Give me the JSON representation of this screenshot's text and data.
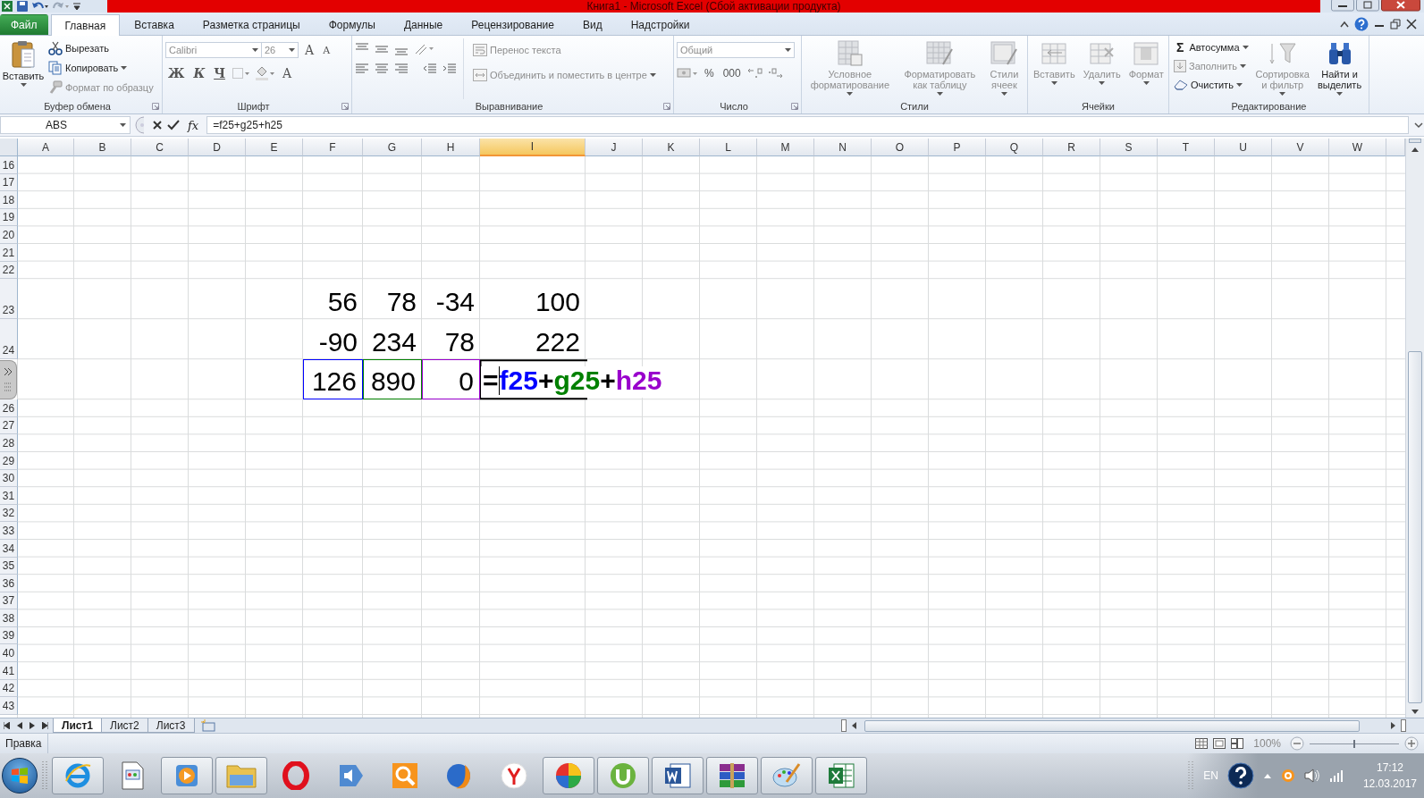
{
  "window": {
    "title": "Книга1  -  Microsoft Excel (Сбой активации продукта)"
  },
  "menu_tabs": [
    {
      "label": "Файл",
      "kind": "file",
      "selected": false
    },
    {
      "label": "Главная",
      "kind": "tab",
      "selected": true
    },
    {
      "label": "Вставка",
      "kind": "tab",
      "selected": false
    },
    {
      "label": "Разметка страницы",
      "kind": "tab",
      "selected": false
    },
    {
      "label": "Формулы",
      "kind": "tab",
      "selected": false
    },
    {
      "label": "Данные",
      "kind": "tab",
      "selected": false
    },
    {
      "label": "Рецензирование",
      "kind": "tab",
      "selected": false
    },
    {
      "label": "Вид",
      "kind": "tab",
      "selected": false
    },
    {
      "label": "Надстройки",
      "kind": "tab",
      "selected": false
    }
  ],
  "ribbon": {
    "clipboard": {
      "title": "Буфер обмена",
      "launcher": true,
      "paste": {
        "label": "Вставить",
        "disabled": false,
        "dropdown": true
      },
      "items": [
        {
          "label": "Вырезать",
          "kind": "cut",
          "disabled": false,
          "dropdown": false
        },
        {
          "label": "Копировать",
          "kind": "copy",
          "disabled": false,
          "dropdown": true
        },
        {
          "label": "Формат по образцу",
          "kind": "painter",
          "disabled": true,
          "dropdown": false
        }
      ]
    },
    "font": {
      "title": "Шрифт",
      "launcher": true,
      "font_name": "Calibri",
      "font_size": "26",
      "size_buttons": [
        {
          "label": "A",
          "kind": "grow"
        },
        {
          "label": "A",
          "kind": "shrink"
        }
      ],
      "styles": [
        {
          "label": "Ж",
          "kind": "bold"
        },
        {
          "label": "К",
          "kind": "italic"
        },
        {
          "label": "Ч",
          "kind": "underline"
        }
      ],
      "color_button": {
        "label": "A"
      }
    },
    "alignment": {
      "title": "Выравнивание",
      "launcher": true,
      "items": [
        {
          "label": "Перенос текста",
          "kind": "wrap",
          "disabled": true,
          "dropdown": false
        },
        {
          "label": "Объединить и поместить в центре",
          "kind": "merge",
          "disabled": true,
          "dropdown": true
        }
      ]
    },
    "number": {
      "title": "Число",
      "launcher": true,
      "format": "Общий",
      "buttons": [
        {
          "label": "%"
        },
        {
          "label": "000"
        }
      ]
    },
    "styles": {
      "title": "Стили",
      "launcher": false,
      "items": [
        {
          "label": "Условное\nформатирование",
          "kind": "conditional",
          "disabled": true,
          "dropdown": true
        },
        {
          "label": "Форматировать\nкак таблицу",
          "kind": "table",
          "disabled": true,
          "dropdown": true
        },
        {
          "label": "Стили\nячеек",
          "kind": "cellstyle",
          "disabled": true,
          "dropdown": true
        }
      ]
    },
    "cells": {
      "title": "Ячейки",
      "launcher": false,
      "items": [
        {
          "label": "Вставить",
          "kind": "insert",
          "disabled": true,
          "dropdown": true
        },
        {
          "label": "Удалить",
          "kind": "delete",
          "disabled": true,
          "dropdown": true
        },
        {
          "label": "Формат",
          "kind": "format",
          "disabled": true,
          "dropdown": true
        }
      ]
    },
    "editing": {
      "title": "Редактирование",
      "launcher": false,
      "small": [
        {
          "label": "Автосумма",
          "kind": "autosum",
          "symbol": "Σ",
          "disabled": false,
          "dropdown": true
        },
        {
          "label": "Заполнить",
          "kind": "fill",
          "disabled": true,
          "dropdown": true
        },
        {
          "label": "Очистить",
          "kind": "clear",
          "disabled": false,
          "dropdown": true
        }
      ],
      "big": [
        {
          "label": "Сортировка\nи фильтр",
          "kind": "sort",
          "disabled": true,
          "dropdown": true
        },
        {
          "label": "Найти и\nвыделить",
          "kind": "find",
          "disabled": false,
          "dropdown": true
        }
      ]
    }
  },
  "formula_bar": {
    "name_box": "ABS",
    "fx": "fx",
    "formula": "=f25+g25+h25"
  },
  "sheet": {
    "columns": [
      {
        "label": "A",
        "selected": false
      },
      {
        "label": "B",
        "selected": false
      },
      {
        "label": "C",
        "selected": false
      },
      {
        "label": "D",
        "selected": false
      },
      {
        "label": "E",
        "selected": false
      },
      {
        "label": "F",
        "selected": false
      },
      {
        "label": "G",
        "selected": false
      },
      {
        "label": "H",
        "selected": false
      },
      {
        "label": "I",
        "selected": true
      },
      {
        "label": "J",
        "selected": false
      },
      {
        "label": "K",
        "selected": false
      },
      {
        "label": "L",
        "selected": false
      },
      {
        "label": "M",
        "selected": false
      },
      {
        "label": "N",
        "selected": false
      },
      {
        "label": "O",
        "selected": false
      },
      {
        "label": "P",
        "selected": false
      },
      {
        "label": "Q",
        "selected": false
      },
      {
        "label": "R",
        "selected": false
      },
      {
        "label": "S",
        "selected": false
      },
      {
        "label": "T",
        "selected": false
      },
      {
        "label": "U",
        "selected": false
      },
      {
        "label": "V",
        "selected": false
      },
      {
        "label": "W",
        "selected": false
      }
    ],
    "rows": [
      {
        "number": "16",
        "kind": "normal"
      },
      {
        "number": "17",
        "kind": "normal"
      },
      {
        "number": "18",
        "kind": "normal"
      },
      {
        "number": "19",
        "kind": "normal"
      },
      {
        "number": "20",
        "kind": "normal"
      },
      {
        "number": "21",
        "kind": "normal"
      },
      {
        "number": "22",
        "kind": "normal"
      },
      {
        "number": "23",
        "kind": "large",
        "cells": [
          {
            "value": "56"
          },
          {
            "value": "78"
          },
          {
            "value": "-34"
          },
          {
            "value": "100"
          }
        ]
      },
      {
        "number": "24",
        "kind": "large",
        "cells": [
          {
            "value": "-90"
          },
          {
            "value": "234"
          },
          {
            "value": "78"
          },
          {
            "value": "222"
          }
        ]
      },
      {
        "kind": "large",
        "cells": [
          {
            "value": "126",
            "color": "#0000ff"
          },
          {
            "value": "890",
            "color": "#008000"
          },
          {
            "value": "0",
            "color": "#9900cc"
          }
        ],
        "editor": {
          "parts": [
            {
              "text": "=",
              "color": "#000000"
            },
            {
              "text": "f25",
              "color": "#0000ff"
            },
            {
              "text": "+",
              "color": "#000000"
            },
            {
              "text": "g25",
              "color": "#008000"
            },
            {
              "text": "+",
              "color": "#000000"
            },
            {
              "text": "h25",
              "color": "#9900cc"
            }
          ]
        }
      },
      {
        "number": "26",
        "kind": "normal"
      },
      {
        "number": "27",
        "kind": "normal"
      },
      {
        "number": "28",
        "kind": "normal"
      },
      {
        "number": "29",
        "kind": "normal"
      },
      {
        "number": "30",
        "kind": "normal"
      },
      {
        "number": "31",
        "kind": "normal"
      },
      {
        "number": "32",
        "kind": "normal"
      },
      {
        "number": "33",
        "kind": "normal"
      },
      {
        "number": "34",
        "kind": "normal"
      },
      {
        "number": "35",
        "kind": "normal"
      },
      {
        "number": "36",
        "kind": "normal"
      },
      {
        "number": "37",
        "kind": "normal"
      },
      {
        "number": "38",
        "kind": "normal"
      },
      {
        "number": "39",
        "kind": "normal"
      },
      {
        "number": "40",
        "kind": "normal"
      },
      {
        "number": "41",
        "kind": "normal"
      },
      {
        "number": "42",
        "kind": "normal"
      },
      {
        "number": "43",
        "kind": "normal"
      }
    ]
  },
  "sheet_tabs": [
    {
      "label": "Лист1",
      "selected": true
    },
    {
      "label": "Лист2",
      "selected": false
    },
    {
      "label": "Лист3",
      "selected": false
    }
  ],
  "status_bar": {
    "mode": "Правка",
    "zoom": "100%",
    "zoom_slider": {
      "level": 0.5
    }
  },
  "taskbar": {
    "apps": [
      {
        "kind": "ie",
        "running": true
      },
      {
        "kind": "document",
        "running": false
      },
      {
        "kind": "media",
        "running": true
      },
      {
        "kind": "folder",
        "running": true
      },
      {
        "kind": "opera",
        "running": false
      },
      {
        "kind": "sound",
        "running": false
      },
      {
        "kind": "search",
        "running": false
      },
      {
        "kind": "globe",
        "running": false
      },
      {
        "kind": "yandex",
        "running": false
      },
      {
        "kind": "colorball",
        "running": true
      },
      {
        "kind": "torrent",
        "running": true
      },
      {
        "kind": "word",
        "running": true
      },
      {
        "kind": "archive",
        "running": true
      },
      {
        "kind": "paint",
        "running": true
      },
      {
        "kind": "excel",
        "running": true
      }
    ],
    "language": "EN",
    "time": "17:12",
    "date": "12.03.2017"
  }
}
